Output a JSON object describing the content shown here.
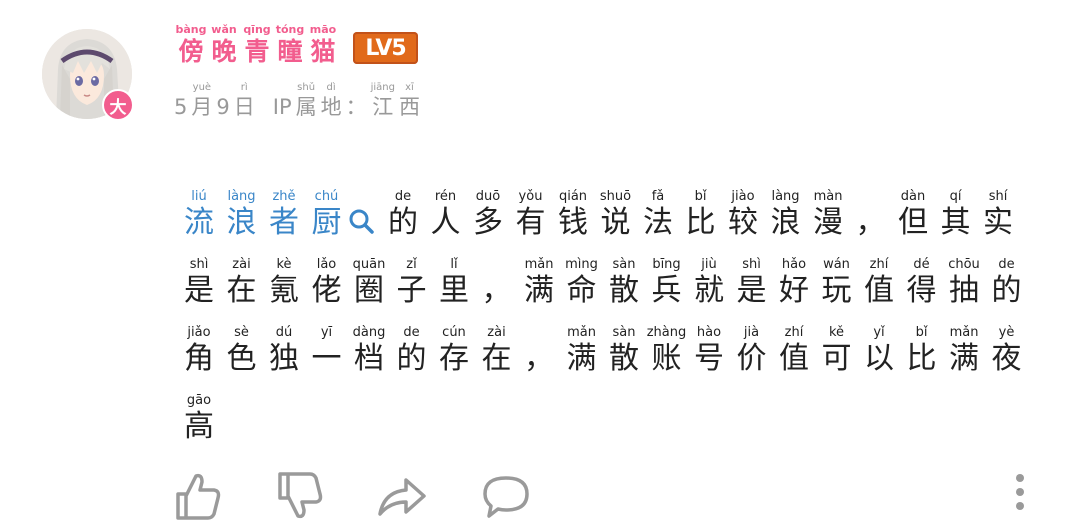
{
  "user": {
    "name": [
      {
        "py": "bàng",
        "hz": "傍"
      },
      {
        "py": "wǎn",
        "hz": "晚"
      },
      {
        "py": "qīng",
        "hz": "青"
      },
      {
        "py": "tóng",
        "hz": "瞳"
      },
      {
        "py": "māo",
        "hz": "猫"
      }
    ],
    "level": "LV5",
    "avatar_badge": "大"
  },
  "meta": {
    "date": "5月9日",
    "date_parts": [
      {
        "plain": "5"
      },
      {
        "py": "yuè",
        "hz": "月"
      },
      {
        "plain": "9"
      },
      {
        "py": "rì",
        "hz": "日"
      }
    ],
    "ip_label": "IP",
    "ip_parts": [
      {
        "py": "shǔ",
        "hz": "属"
      },
      {
        "py": "dì",
        "hz": "地"
      },
      {
        "py": "",
        "hz": "："
      },
      {
        "py": "jiāng",
        "hz": "江"
      },
      {
        "py": "xī",
        "hz": "西"
      }
    ]
  },
  "comment": {
    "link_text": "流浪者厨",
    "lines": [
      [
        {
          "py": "liú",
          "hz": "流",
          "link": true
        },
        {
          "py": "làng",
          "hz": "浪",
          "link": true
        },
        {
          "py": "zhě",
          "hz": "者",
          "link": true
        },
        {
          "py": "chú",
          "hz": "厨",
          "link": true
        },
        {
          "search": true
        },
        {
          "py": "de",
          "hz": "的"
        },
        {
          "py": "rén",
          "hz": "人"
        },
        {
          "py": "duō",
          "hz": "多"
        },
        {
          "py": "yǒu",
          "hz": "有"
        },
        {
          "py": "qián",
          "hz": "钱"
        },
        {
          "py": "shuō",
          "hz": "说"
        },
        {
          "py": "fǎ",
          "hz": "法"
        },
        {
          "py": "bǐ",
          "hz": "比"
        },
        {
          "py": "jiào",
          "hz": "较"
        },
        {
          "py": "làng",
          "hz": "浪"
        },
        {
          "py": "màn",
          "hz": "漫"
        },
        {
          "py": "",
          "hz": "，"
        },
        {
          "py": "dàn",
          "hz": "但"
        },
        {
          "py": "qí",
          "hz": "其"
        },
        {
          "py": "shí",
          "hz": "实"
        }
      ],
      [
        {
          "py": "shì",
          "hz": "是"
        },
        {
          "py": "zài",
          "hz": "在"
        },
        {
          "py": "kè",
          "hz": "氪"
        },
        {
          "py": "lǎo",
          "hz": "佬"
        },
        {
          "py": "quān",
          "hz": "圈"
        },
        {
          "py": "zǐ",
          "hz": "子"
        },
        {
          "py": "lǐ",
          "hz": "里"
        },
        {
          "py": "",
          "hz": "，"
        },
        {
          "py": "mǎn",
          "hz": "满"
        },
        {
          "py": "mìng",
          "hz": "命"
        },
        {
          "py": "sàn",
          "hz": "散"
        },
        {
          "py": "bīng",
          "hz": "兵"
        },
        {
          "py": "jiù",
          "hz": "就"
        },
        {
          "py": "shì",
          "hz": "是"
        },
        {
          "py": "hǎo",
          "hz": "好"
        },
        {
          "py": "wán",
          "hz": "玩"
        },
        {
          "py": "zhí",
          "hz": "值"
        },
        {
          "py": "dé",
          "hz": "得"
        },
        {
          "py": "chōu",
          "hz": "抽"
        },
        {
          "py": "de",
          "hz": "的"
        }
      ],
      [
        {
          "py": "jiǎo",
          "hz": "角"
        },
        {
          "py": "sè",
          "hz": "色"
        },
        {
          "py": "dú",
          "hz": "独"
        },
        {
          "py": "yī",
          "hz": "一"
        },
        {
          "py": "dàng",
          "hz": "档"
        },
        {
          "py": "de",
          "hz": "的"
        },
        {
          "py": "cún",
          "hz": "存"
        },
        {
          "py": "zài",
          "hz": "在"
        },
        {
          "py": "",
          "hz": "，"
        },
        {
          "py": "mǎn",
          "hz": "满"
        },
        {
          "py": "sàn",
          "hz": "散"
        },
        {
          "py": "zhàng",
          "hz": "账"
        },
        {
          "py": "hào",
          "hz": "号"
        },
        {
          "py": "jià",
          "hz": "价"
        },
        {
          "py": "zhí",
          "hz": "值"
        },
        {
          "py": "kě",
          "hz": "可"
        },
        {
          "py": "yǐ",
          "hz": "以"
        },
        {
          "py": "bǐ",
          "hz": "比"
        },
        {
          "py": "mǎn",
          "hz": "满"
        },
        {
          "py": "yè",
          "hz": "夜"
        }
      ],
      [
        {
          "py": "gāo",
          "hz": "高"
        }
      ]
    ]
  },
  "actions": {
    "icons": [
      "thumbs-up-icon",
      "thumbs-down-icon",
      "share-icon",
      "comment-icon",
      "more-icon"
    ]
  },
  "colors": {
    "username": "#f25d8e",
    "level_badge": "#e16a1b",
    "link": "#3a86c8",
    "meta": "#999999",
    "text": "#222222",
    "icon": "#9a9a9a"
  }
}
